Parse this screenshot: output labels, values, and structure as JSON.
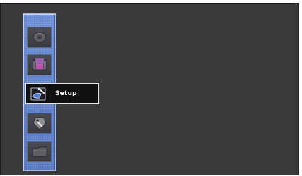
{
  "menu": {
    "items": [
      {
        "icon": "disc-icon",
        "label": ""
      },
      {
        "icon": "movie-icon",
        "label": ""
      },
      {
        "icon": "setup-icon",
        "label": "Setup",
        "selected": true
      },
      {
        "icon": "tag-icon",
        "label": ""
      },
      {
        "icon": "folder-icon",
        "label": ""
      }
    ]
  },
  "colors": {
    "background": "#3a3a3a",
    "sidebar": "#6384cf",
    "selected_background": "#101010",
    "selected_border": "#e6e6e6",
    "selected_text": "#ffffff"
  }
}
